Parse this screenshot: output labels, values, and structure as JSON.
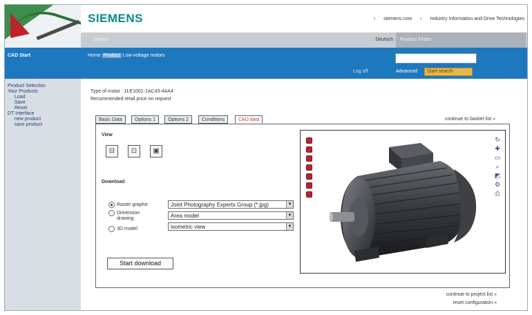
{
  "header": {
    "brand": "SIEMENS",
    "link_siemens": "siemens.com",
    "link_industry": "Industry Information and Drive Technologies"
  },
  "grey_bar": {
    "search_text": "Search",
    "language": "Deutsch",
    "language_box": "Product Finder"
  },
  "left": {
    "blue_label": "CAD Start",
    "nav": [
      "Product Selection",
      "Your Products",
      "Load",
      "Save",
      "Reset",
      "DT Interface",
      "new product",
      "save product"
    ]
  },
  "blue_bar": {
    "breadcrumb_home": "Home",
    "breadcrumb_product": "Product",
    "breadcrumb_tail": "Low-voltage motors",
    "logout": "Log off",
    "advanced_search": "Advanced",
    "search_button": "Start search"
  },
  "content": {
    "motor_type": "Type of motor : 1LE1001-1AC43-4AA4",
    "recommended": "Recommended retail price on request"
  },
  "tabs": [
    "Basic Data",
    "Options 1",
    "Options 2",
    "Conditions",
    "CAD data"
  ],
  "continue_link": "continue to basket list",
  "pane": {
    "view_label": "View",
    "download_label": "Download",
    "option_raster": "Raster graphic",
    "option_dimension": "Dimension drawing",
    "option_3d": "3D model",
    "select_format": "Joint Photography Experts Group (*.jpg)",
    "select_model": "Area model",
    "select_view": "isometric view",
    "start_download": "Start download"
  },
  "bottom": {
    "link_project": "continue to project list",
    "link_reset": "reset configuration"
  },
  "icons": {
    "view_buttons": [
      "front-view-icon",
      "side-view-icon",
      "iso-view-icon"
    ],
    "viewer_left": [
      "red-tool-1-icon",
      "red-tool-2-icon",
      "red-tool-3-icon",
      "red-tool-4-icon",
      "red-tool-5-icon",
      "red-tool-6-icon",
      "red-tool-7-icon"
    ],
    "viewer_right": [
      "refresh-icon",
      "plus-icon",
      "window-icon",
      "zoom-icon",
      "rotate-icon",
      "settings-icon",
      "print-icon"
    ]
  },
  "colors": {
    "brand": "#0b8a8a",
    "blue_bar": "#1e78be",
    "active_tab": "#d2352b",
    "search_button": "#e8b64a"
  }
}
